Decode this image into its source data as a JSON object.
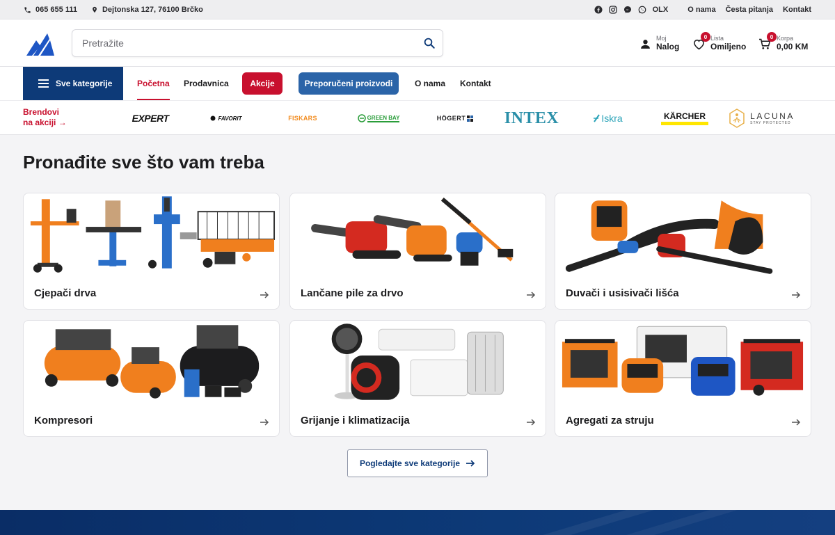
{
  "topbar": {
    "phone": "065 655 111",
    "address": "Dejtonska 127, 76100 Brčko",
    "olx": "OLX",
    "links": [
      "O nama",
      "Česta pitanja",
      "Kontakt"
    ]
  },
  "header": {
    "search_placeholder": "Pretražite",
    "account": {
      "small": "Moj",
      "big": "Nalog"
    },
    "wishlist": {
      "small": "Lista",
      "big": "Omiljeno",
      "count": "0"
    },
    "cart": {
      "small": "Korpa",
      "big": "0,00 KM",
      "count": "0"
    }
  },
  "nav": {
    "all_categories": "Sve kategorije",
    "links": [
      "Početna",
      "Prodavnica"
    ],
    "promo": "Akcije",
    "recommended": "Preporučeni proizvodi",
    "more_links": [
      "O nama",
      "Kontakt"
    ]
  },
  "brands": {
    "label_line1": "Brendovi",
    "label_line2": "na akciji →",
    "items": [
      "EXPERT",
      "FAVORIT",
      "FISKARS",
      "GREEN BAY",
      "HÖGERT",
      "INTEX",
      "Iskra",
      "KÄRCHER",
      "LACUNA",
      "STAY PROTECTED"
    ]
  },
  "main": {
    "heading": "Pronađite sve što vam treba",
    "categories": [
      "Cjepači drva",
      "Lančane pile za drvo",
      "Duvači i usisivači lišća",
      "Kompresori",
      "Grijanje i klimatizacija",
      "Agregati za struju"
    ],
    "all_button": "Pogledajte sve kategorije"
  },
  "colors": {
    "brand_blue": "#0d3a78",
    "accent_red": "#c8102e",
    "recommended_blue": "#2b64a8"
  }
}
